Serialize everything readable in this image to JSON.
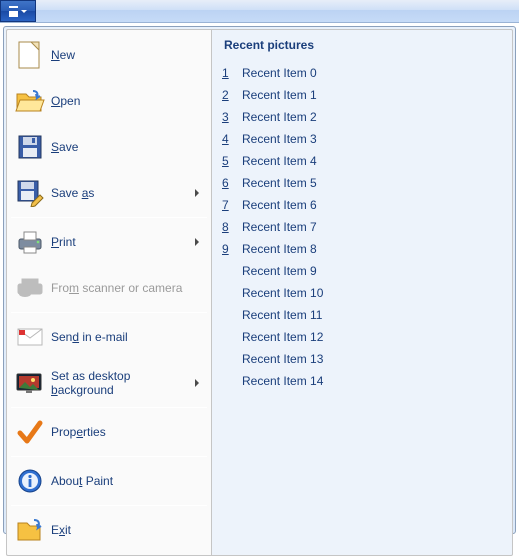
{
  "titlebar": {},
  "menu": {
    "items": [
      {
        "id": "new",
        "label_pre": "",
        "label_u": "N",
        "label_post": "ew",
        "sub": false,
        "disabled": false
      },
      {
        "id": "open",
        "label_pre": "",
        "label_u": "O",
        "label_post": "pen",
        "sub": false,
        "disabled": false
      },
      {
        "id": "save",
        "label_pre": "",
        "label_u": "S",
        "label_post": "ave",
        "sub": false,
        "disabled": false
      },
      {
        "id": "saveas",
        "label_pre": "Save ",
        "label_u": "a",
        "label_post": "s",
        "sub": true,
        "disabled": false
      },
      {
        "sep": true
      },
      {
        "id": "print",
        "label_pre": "",
        "label_u": "P",
        "label_post": "rint",
        "sub": true,
        "disabled": false
      },
      {
        "id": "scanner",
        "label_pre": "Fro",
        "label_u": "m",
        "label_post": " scanner or camera",
        "sub": false,
        "disabled": true
      },
      {
        "sep": true
      },
      {
        "id": "email",
        "label_pre": "Sen",
        "label_u": "d",
        "label_post": " in e-mail",
        "sub": false,
        "disabled": false
      },
      {
        "id": "wallpaper",
        "label_pre": "Set as desktop ",
        "label_u": "b",
        "label_post": "ackground",
        "sub": true,
        "disabled": false
      },
      {
        "sep": true
      },
      {
        "id": "properties",
        "label_pre": "Prop",
        "label_u": "e",
        "label_post": "rties",
        "sub": false,
        "disabled": false
      },
      {
        "sep": true
      },
      {
        "id": "about",
        "label_pre": "Abou",
        "label_u": "t",
        "label_post": " Paint",
        "sub": false,
        "disabled": false
      },
      {
        "sep": true
      },
      {
        "id": "exit",
        "label_pre": "E",
        "label_u": "x",
        "label_post": "it",
        "sub": false,
        "disabled": false
      }
    ]
  },
  "recent": {
    "header": "Recent pictures",
    "items": [
      {
        "num": "1",
        "label": "Recent Item 0"
      },
      {
        "num": "2",
        "label": "Recent Item 1"
      },
      {
        "num": "3",
        "label": "Recent Item 2"
      },
      {
        "num": "4",
        "label": "Recent Item 3"
      },
      {
        "num": "5",
        "label": "Recent Item 4"
      },
      {
        "num": "6",
        "label": "Recent Item 5"
      },
      {
        "num": "7",
        "label": "Recent Item 6"
      },
      {
        "num": "8",
        "label": "Recent Item 7"
      },
      {
        "num": "9",
        "label": "Recent Item 8"
      },
      {
        "num": "",
        "label": "Recent Item 9"
      },
      {
        "num": "",
        "label": "Recent Item 10"
      },
      {
        "num": "",
        "label": "Recent Item 11"
      },
      {
        "num": "",
        "label": "Recent Item 12"
      },
      {
        "num": "",
        "label": "Recent Item 13"
      },
      {
        "num": "",
        "label": "Recent Item 14"
      }
    ]
  },
  "icons": {
    "new": "new-file-icon",
    "open": "open-folder-icon",
    "save": "save-disk-icon",
    "saveas": "save-as-icon",
    "print": "printer-icon",
    "scanner": "scanner-icon",
    "email": "email-icon",
    "wallpaper": "wallpaper-icon",
    "properties": "checkmark-icon",
    "about": "info-icon",
    "exit": "exit-icon"
  }
}
